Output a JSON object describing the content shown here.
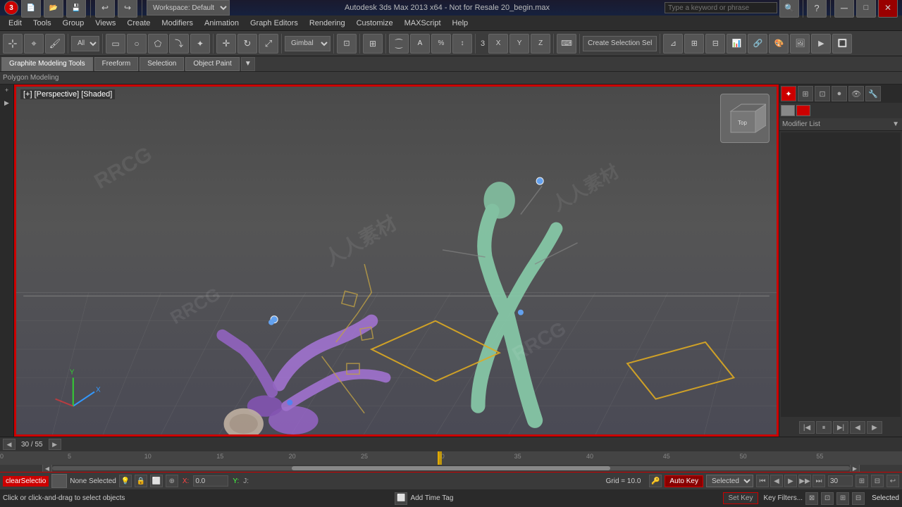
{
  "titlebar": {
    "app_icon": "3dsmax-icon",
    "title": "Autodesk 3ds Max 2013 x64 - Not for Resale  20_begin.max",
    "search_placeholder": "Type a keyword or phrase",
    "workspace_label": "Workspace: Default"
  },
  "menubar": {
    "items": [
      "Edit",
      "Tools",
      "Group",
      "Views",
      "Create",
      "Modifiers",
      "Animation",
      "Graph Editors",
      "Rendering",
      "Customize",
      "MAXScript",
      "Help"
    ]
  },
  "toolbar": {
    "mode_label": "All",
    "gimbal_label": "Gimbal",
    "create_selection_label": "Create Selection Sel",
    "coordinate_mode": "3",
    "icons": [
      "select",
      "move",
      "rotate",
      "scale",
      "link",
      "unlink",
      "hierarchy",
      "pin",
      "transform",
      "mirror",
      "array",
      "snap",
      "angle-snap",
      "percent-snap",
      "spinner-snap",
      "edit-named-sel"
    ]
  },
  "modeling_toolbar": {
    "tabs": [
      "Graphite Modeling Tools",
      "Freeform",
      "Selection",
      "Object Paint"
    ],
    "active_tab": "Graphite Modeling Tools"
  },
  "poly_label": "Polygon Modeling",
  "viewport": {
    "label": "[+] [Perspective] [Shaded]",
    "border_color": "#cc0000"
  },
  "right_panel": {
    "modifier_list_label": "Modifier List",
    "color_swatches": [
      "#888888",
      "#cc0000"
    ]
  },
  "timeline": {
    "frame_current": "30",
    "frame_total": "55",
    "ruler_marks": [
      "0",
      "5",
      "10",
      "15",
      "20",
      "25",
      "30",
      "35",
      "40",
      "45",
      "50",
      "55"
    ],
    "playhead_position": "30"
  },
  "statusbar": {
    "top": {
      "clear_selection_label": "clearSelectio",
      "status": "None Selected",
      "grid_label": "Grid = 10.0",
      "auto_key_label": "Auto Key",
      "selected_label": "Selected",
      "set_key_label": "Set Key",
      "key_filters_label": "Key Filters..."
    },
    "bottom": {
      "hint": "Click or click-and-drag to select objects",
      "selected_status": "Selected"
    }
  }
}
